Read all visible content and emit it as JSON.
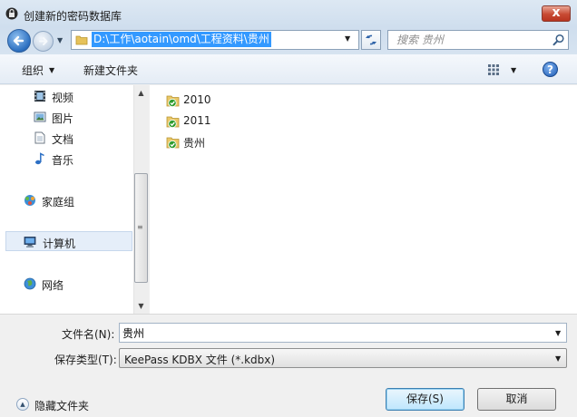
{
  "window": {
    "title": "创建新的密码数据库",
    "close_glyph": "x"
  },
  "address": {
    "path": "D:\\工作\\aotain\\omd\\工程资料\\贵州"
  },
  "search": {
    "placeholder": "搜索 贵州"
  },
  "toolbar": {
    "organize_label": "组织",
    "new_folder_label": "新建文件夹",
    "help_glyph": "?"
  },
  "nav": {
    "items": [
      {
        "label": "视频",
        "icon": "video-icon"
      },
      {
        "label": "图片",
        "icon": "pictures-icon"
      },
      {
        "label": "文档",
        "icon": "documents-icon"
      },
      {
        "label": "音乐",
        "icon": "music-icon"
      },
      {
        "label": "家庭组",
        "icon": "homegroup-icon"
      },
      {
        "label": "计算机",
        "icon": "computer-icon",
        "selected": true
      },
      {
        "label": "网络",
        "icon": "network-icon"
      }
    ]
  },
  "files": {
    "items": [
      {
        "name": "2010",
        "icon": "synced-folder-icon"
      },
      {
        "name": "2011",
        "icon": "synced-folder-icon"
      },
      {
        "name": "贵州",
        "icon": "synced-folder-icon"
      }
    ]
  },
  "form": {
    "filename_label": "文件名(N):",
    "filename_value": "贵州",
    "type_label": "保存类型(T):",
    "type_value": "KeePass KDBX 文件 (*.kdbx)"
  },
  "footer": {
    "hide_folders_label": "隐藏文件夹",
    "save_label": "保存(S)",
    "cancel_label": "取消"
  },
  "colors": {
    "selection": "#3399ff",
    "titlebar": "#dde8f3",
    "close_button": "#c84a33",
    "folder_check": "#2e9c2e"
  }
}
